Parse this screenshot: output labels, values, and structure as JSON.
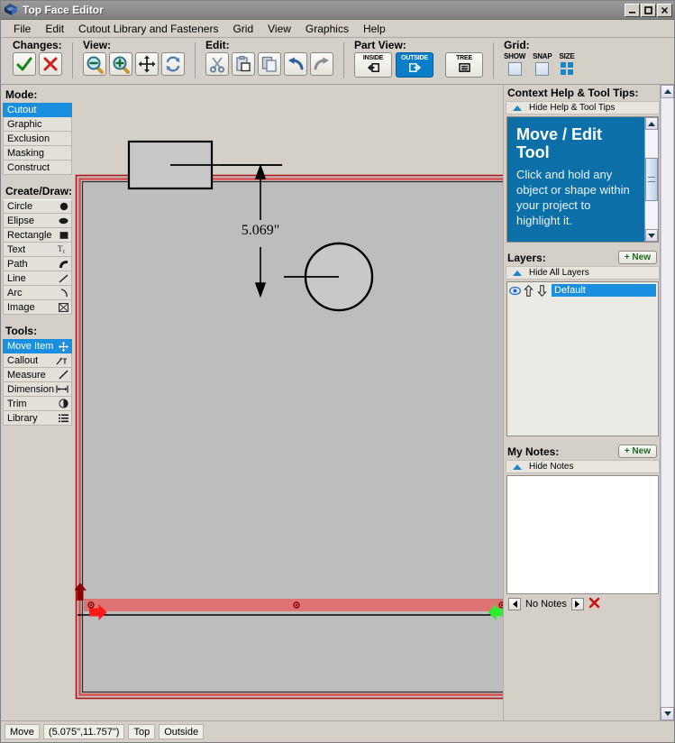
{
  "window": {
    "title": "Top Face Editor",
    "icon": "app-logo-icon",
    "minimize_label": "_",
    "maximize_label": "□",
    "close_label": "×"
  },
  "menubar": {
    "items": [
      {
        "label": "File"
      },
      {
        "label": "Edit"
      },
      {
        "label": "Cutout Library and Fasteners"
      },
      {
        "label": "Grid"
      },
      {
        "label": "View"
      },
      {
        "label": "Graphics"
      },
      {
        "label": "Help"
      }
    ]
  },
  "toolbar": {
    "groups": [
      {
        "label": "Changes:",
        "buttons": [
          {
            "name": "accept-changes-button",
            "icon": "check-icon"
          },
          {
            "name": "cancel-changes-button",
            "icon": "cross-icon"
          }
        ]
      },
      {
        "label": "View:",
        "buttons": [
          {
            "name": "zoom-out-button",
            "icon": "zoom-out-icon"
          },
          {
            "name": "zoom-in-button",
            "icon": "zoom-in-icon"
          },
          {
            "name": "pan-button",
            "icon": "move-arrows-icon"
          },
          {
            "name": "refresh-view-button",
            "icon": "refresh-icon"
          }
        ]
      },
      {
        "label": "Edit:",
        "buttons": [
          {
            "name": "cut-button",
            "icon": "scissors-icon"
          },
          {
            "name": "paste-button",
            "icon": "paste-icon"
          },
          {
            "name": "copy-button",
            "icon": "copy-icon"
          },
          {
            "name": "undo-button",
            "icon": "undo-arrow-icon"
          },
          {
            "name": "redo-button",
            "icon": "redo-arrow-icon"
          }
        ]
      }
    ],
    "part_view": {
      "label": "Part View:",
      "inside_label": "INSIDE",
      "outside_label": "OUTSIDE",
      "tree_label": "TREE",
      "selected": "OUTSIDE"
    },
    "grid": {
      "label": "Grid:",
      "show_label": "SHOW",
      "snap_label": "SNAP",
      "size_label": "SIZE",
      "show_checked": false,
      "snap_checked": false
    }
  },
  "left_panel": {
    "mode": {
      "title": "Mode:",
      "selected": "Cutout",
      "items": [
        {
          "label": "Cutout"
        },
        {
          "label": "Graphic"
        },
        {
          "label": "Exclusion"
        },
        {
          "label": "Masking"
        },
        {
          "label": "Construct"
        }
      ]
    },
    "create_draw": {
      "title": "Create/Draw:",
      "items": [
        {
          "label": "Circle",
          "icon": "filled-circle-icon"
        },
        {
          "label": "Elipse",
          "icon": "filled-ellipse-icon"
        },
        {
          "label": "Rectangle",
          "icon": "filled-square-icon"
        },
        {
          "label": "Text",
          "icon": "text-tool-icon"
        },
        {
          "label": "Path",
          "icon": "path-curve-icon"
        },
        {
          "label": "Line",
          "icon": "line-icon"
        },
        {
          "label": "Arc",
          "icon": "arc-icon"
        },
        {
          "label": "Image",
          "icon": "image-box-icon"
        }
      ]
    },
    "tools": {
      "title": "Tools:",
      "selected": "Move Item",
      "items": [
        {
          "label": "Move Item",
          "icon": "move-arrows-icon"
        },
        {
          "label": "Callout",
          "icon": "callout-icon"
        },
        {
          "label": "Measure",
          "icon": "measure-ruler-icon"
        },
        {
          "label": "Dimension",
          "icon": "dimension-icon"
        },
        {
          "label": "Trim",
          "icon": "trim-icon"
        },
        {
          "label": "Library",
          "icon": "library-list-icon"
        }
      ]
    }
  },
  "canvas": {
    "dimension_label": "5.069\"",
    "part_outline_color": "#cc2222",
    "part_fill_color": "#bdbdbd",
    "highlight_bar_color": "#e06a6a",
    "shapes": [
      {
        "name": "rectangle-cutout",
        "type": "rectangle"
      },
      {
        "name": "circle-cutout",
        "type": "circle"
      },
      {
        "name": "dimension-arrow",
        "type": "dimension"
      }
    ]
  },
  "right_panel": {
    "help": {
      "title": "Context Help & Tool Tips:",
      "hide_label": "Hide Help & Tool Tips",
      "heading": "Move / Edit Tool",
      "body": "Click and hold any object or shape within your project to highlight it."
    },
    "layers": {
      "title": "Layers:",
      "new_label": "+ New",
      "hide_label": "Hide All Layers",
      "items": [
        {
          "name": "Default",
          "visible": true,
          "selected": true
        }
      ]
    },
    "notes": {
      "title": "My Notes:",
      "new_label": "+ New",
      "hide_label": "Hide Notes",
      "content": "",
      "status": "No Notes",
      "prev_label": "◀",
      "next_label": "▶",
      "delete_label": "✖"
    }
  },
  "statusbar": {
    "mode": "Move",
    "coordinates": "(5.075\",11.757\")",
    "face": "Top",
    "side": "Outside"
  }
}
